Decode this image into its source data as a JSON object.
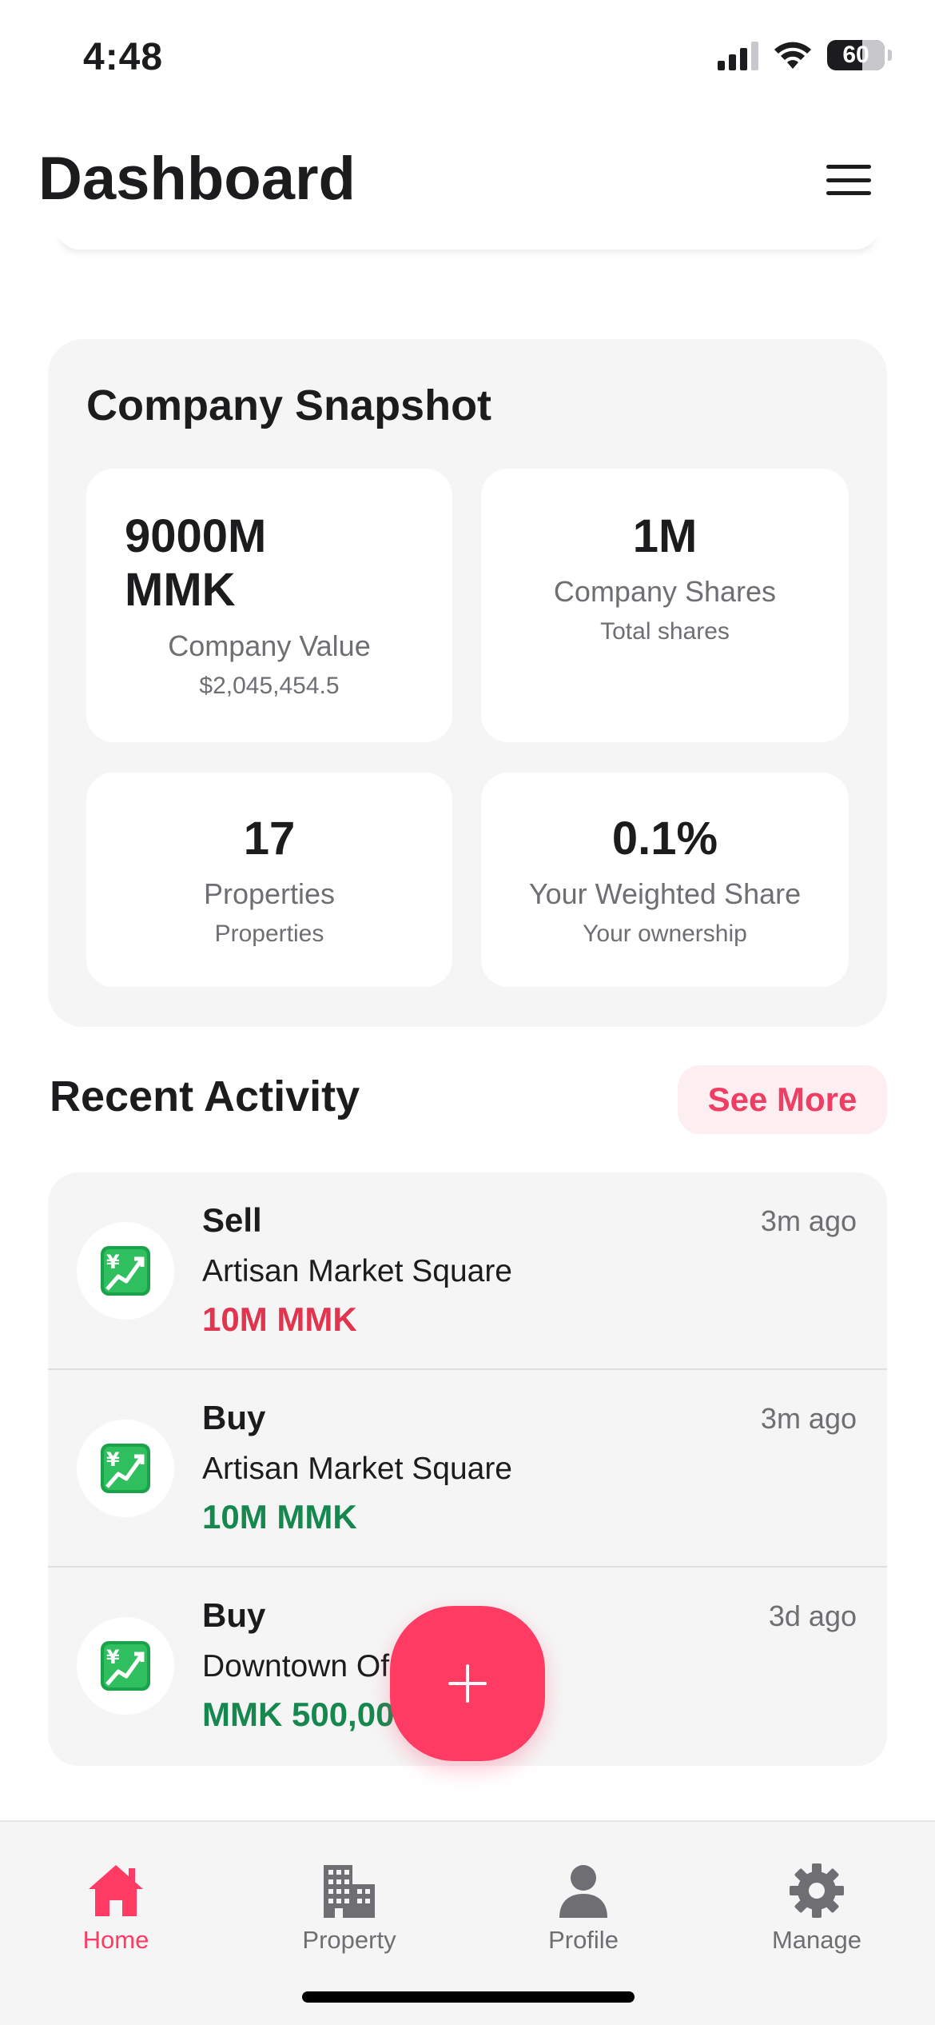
{
  "status_bar": {
    "time": "4:48",
    "battery": "60"
  },
  "header": {
    "title": "Dashboard",
    "menu_icon": "hamburger-menu-icon"
  },
  "snapshot": {
    "title": "Company Snapshot",
    "stats": [
      {
        "value": "9000M MMK",
        "label": "Company Value",
        "sub": "$2,045,454.5"
      },
      {
        "value": "1M",
        "label": "Company Shares",
        "sub": "Total shares"
      },
      {
        "value": "17",
        "label": "Properties",
        "sub": "Properties"
      },
      {
        "value": "0.1%",
        "label": "Your Weighted Share",
        "sub": "Your ownership"
      }
    ]
  },
  "activity": {
    "heading": "Recent Activity",
    "see_more": "See More",
    "items": [
      {
        "type": "Sell",
        "property": "Artisan Market Square",
        "amount": "10M MMK",
        "time": "3m ago",
        "amount_color": "#e0344f",
        "icon": "chart-increasing-with-yen-icon"
      },
      {
        "type": "Buy",
        "property": "Artisan Market Square",
        "amount": "10M MMK",
        "time": "3m ago",
        "amount_color": "#16884f",
        "icon": "chart-increasing-with-yen-icon"
      },
      {
        "type": "Buy",
        "property": "Downtown Of",
        "amount": "MMK 500,00",
        "time": "3d ago",
        "amount_color": "#16884f",
        "icon": "chart-increasing-with-yen-icon"
      }
    ]
  },
  "fab": {
    "icon": "plus-icon",
    "color": "#ff3b64"
  },
  "tabs": [
    {
      "label": "Home",
      "icon": "home-icon",
      "active": true
    },
    {
      "label": "Property",
      "icon": "building-icon",
      "active": false
    },
    {
      "label": "Profile",
      "icon": "person-icon",
      "active": false
    },
    {
      "label": "Manage",
      "icon": "gear-icon",
      "active": false
    }
  ],
  "colors": {
    "accent": "#ff3b64",
    "sell": "#e0344f",
    "buy": "#16884f",
    "card_bg": "#f5f5f5"
  }
}
